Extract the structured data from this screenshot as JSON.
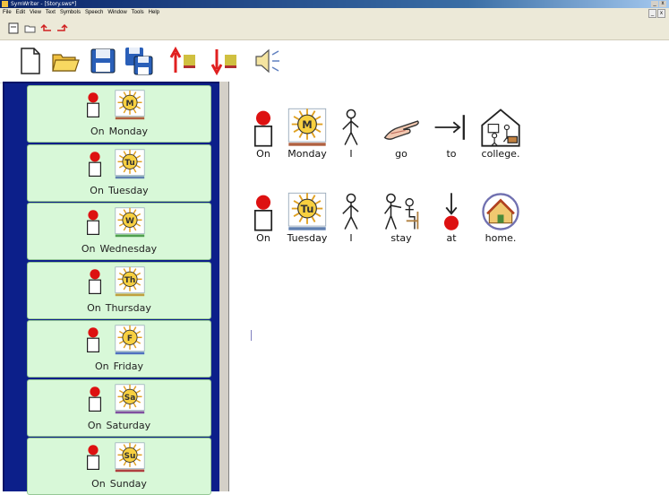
{
  "window": {
    "title": "SymWriter - [Story.sws*]"
  },
  "menu": [
    "File",
    "Edit",
    "View",
    "Text",
    "Symbols",
    "Speech",
    "Window",
    "Tools",
    "Help"
  ],
  "toolbar_small": [
    "new-doc-icon",
    "open-folder-icon",
    "undo-icon",
    "redo-icon"
  ],
  "toolbar_large": [
    "new-document-icon",
    "open-folder-icon",
    "save-icon",
    "save-as-icon",
    "move-up-icon",
    "move-down-icon",
    "speaker-icon"
  ],
  "sidebar": {
    "items": [
      {
        "on": "On",
        "day": "Monday",
        "badge": "M",
        "bar_color": "#b06040"
      },
      {
        "on": "On",
        "day": "Tuesday",
        "badge": "Tu",
        "bar_color": "#6080b0"
      },
      {
        "on": "On",
        "day": "Wednesday",
        "badge": "W",
        "bar_color": "#50a050"
      },
      {
        "on": "On",
        "day": "Thursday",
        "badge": "Th",
        "bar_color": "#c0a040"
      },
      {
        "on": "On",
        "day": "Friday",
        "badge": "F",
        "bar_color": "#5070c0"
      },
      {
        "on": "On",
        "day": "Saturday",
        "badge": "Sa",
        "bar_color": "#8050a0"
      },
      {
        "on": "On",
        "day": "Sunday",
        "badge": "Su",
        "bar_color": "#b04040"
      }
    ]
  },
  "document": {
    "line1": [
      {
        "text": "On",
        "symbol": "figure-dot"
      },
      {
        "text": "Monday",
        "symbol": "sun-M"
      },
      {
        "text": "I",
        "symbol": "stick-figure"
      },
      {
        "text": "go",
        "symbol": "pointing-hand"
      },
      {
        "text": "to",
        "symbol": "arrow-to-line"
      },
      {
        "text": "college.",
        "symbol": "house-people"
      }
    ],
    "line2": [
      {
        "text": "On",
        "symbol": "figure-dot"
      },
      {
        "text": "Tuesday",
        "symbol": "sun-Tu"
      },
      {
        "text": "I",
        "symbol": "stick-figure"
      },
      {
        "text": "stay",
        "symbol": "stick-figure-chair"
      },
      {
        "text": "at",
        "symbol": "arrow-to-dot"
      },
      {
        "text": "home.",
        "symbol": "home-circle"
      }
    ]
  },
  "colors": {
    "sidebar_bg": "#0c1f8a",
    "card_bg": "#d8f8d8",
    "red_dot": "#dd1111"
  }
}
